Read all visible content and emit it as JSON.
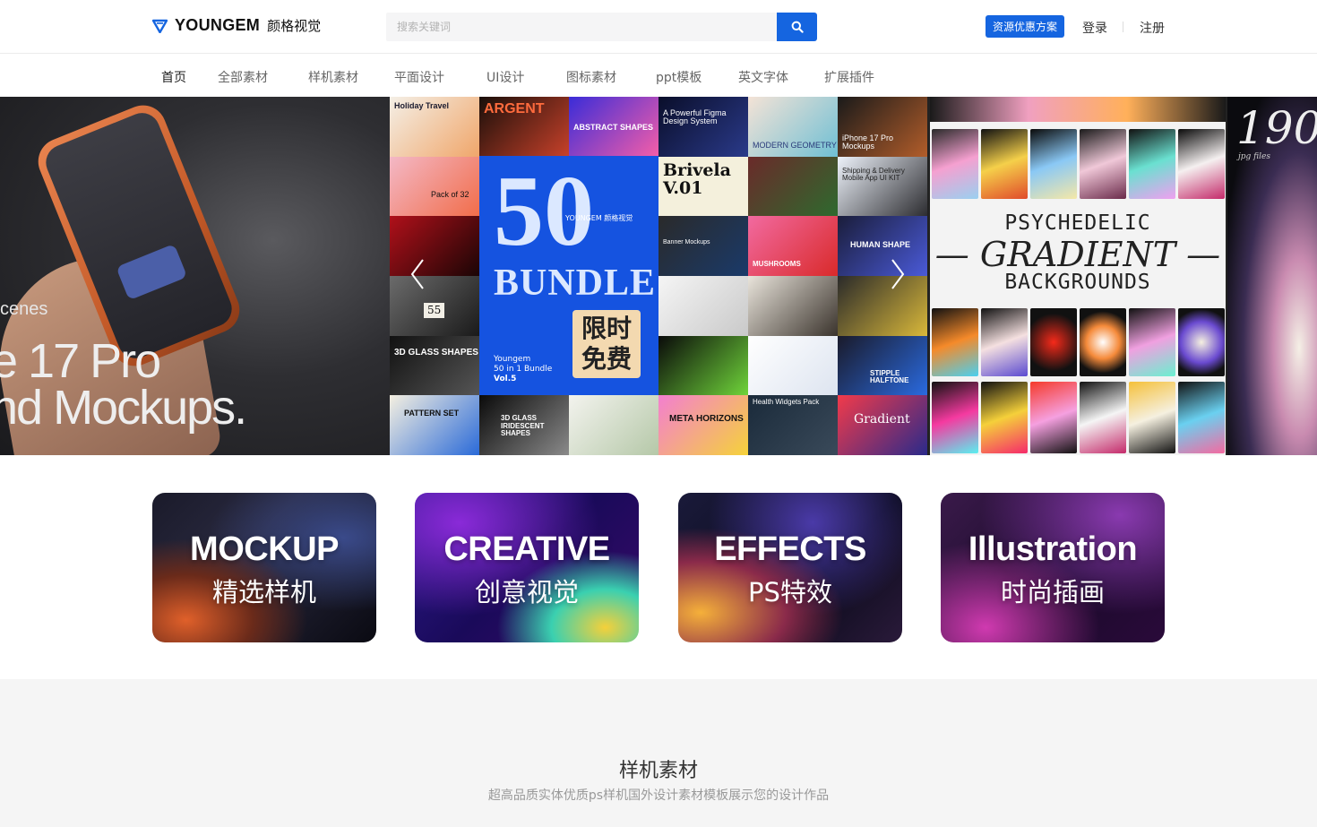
{
  "header": {
    "logo_en": "YOUNGEM",
    "logo_cn": "颜格视觉",
    "search_placeholder": "搜索关键词",
    "promo_label": "资源优惠方案",
    "login_label": "登录",
    "register_label": "注册"
  },
  "nav": {
    "items": [
      {
        "label": "首页"
      },
      {
        "label": "全部素材"
      },
      {
        "label": "样机素材"
      },
      {
        "label": "平面设计"
      },
      {
        "label": "UI设计"
      },
      {
        "label": "图标素材"
      },
      {
        "label": "ppt模板"
      },
      {
        "label": "英文字体"
      },
      {
        "label": "扩展插件"
      }
    ],
    "active_index": 0
  },
  "banner": {
    "left": {
      "line1": "cenes",
      "line2": "e 17 Pro",
      "line3": "nd Mockups."
    },
    "center": {
      "tiles": [
        "Holiday Travel",
        "ARGENT",
        "ABSTRACT SHAPES",
        "A Powerful Figma Design System",
        "MODERN GEOMETRY",
        "iPhone 17 Pro Mockups",
        "Pack of 32",
        "Brivela V.01",
        "Shipping & Delivery Mobile App UI KIT",
        "Banner Mockups",
        "HUMAN SHAPE",
        "55",
        "MUSHROOMS",
        "3D GLASS SHAPES",
        "STIPPLE HALFTONE",
        "PATTERN SET",
        "3D GLASS IRIDESCENT SHAPES",
        "META HORIZONS",
        "Health Widgets Pack",
        "Gradient"
      ],
      "big_number": "50",
      "big_word": "BUNDLE",
      "big_brand": "YOUNGEM 颜格视觉",
      "big_free": "限时免费",
      "big_small_1": "Youngem",
      "big_small_2": "50 in 1 Bundle",
      "big_small_3": "Vol.5"
    },
    "right": {
      "line1": "PSYCHEDELIC",
      "line2": "— GRADIENT —",
      "line3": "BACKGROUNDS"
    },
    "far": {
      "number": "190",
      "sub": "jpg files"
    }
  },
  "cards": [
    {
      "title": "MOCKUP",
      "subtitle": "精选样机"
    },
    {
      "title": "CREATIVE",
      "subtitle": "创意视觉"
    },
    {
      "title": "EFFECTS",
      "subtitle": "PS特效"
    },
    {
      "title": "Illustration",
      "subtitle": "时尚插画"
    }
  ],
  "section": {
    "title": "样机素材",
    "subtitle": "超高品质实体优质ps样机国外设计素材模板展示您的设计作品"
  },
  "colors": {
    "accent": "#1565e0",
    "nav_active": "#222222",
    "nav_text": "#666666",
    "section_bg": "#f5f5f5"
  },
  "icons": {
    "logo": "youngem-diamond-logo-icon",
    "search": "search-icon",
    "prev": "chevron-left-icon",
    "next": "chevron-right-icon"
  }
}
